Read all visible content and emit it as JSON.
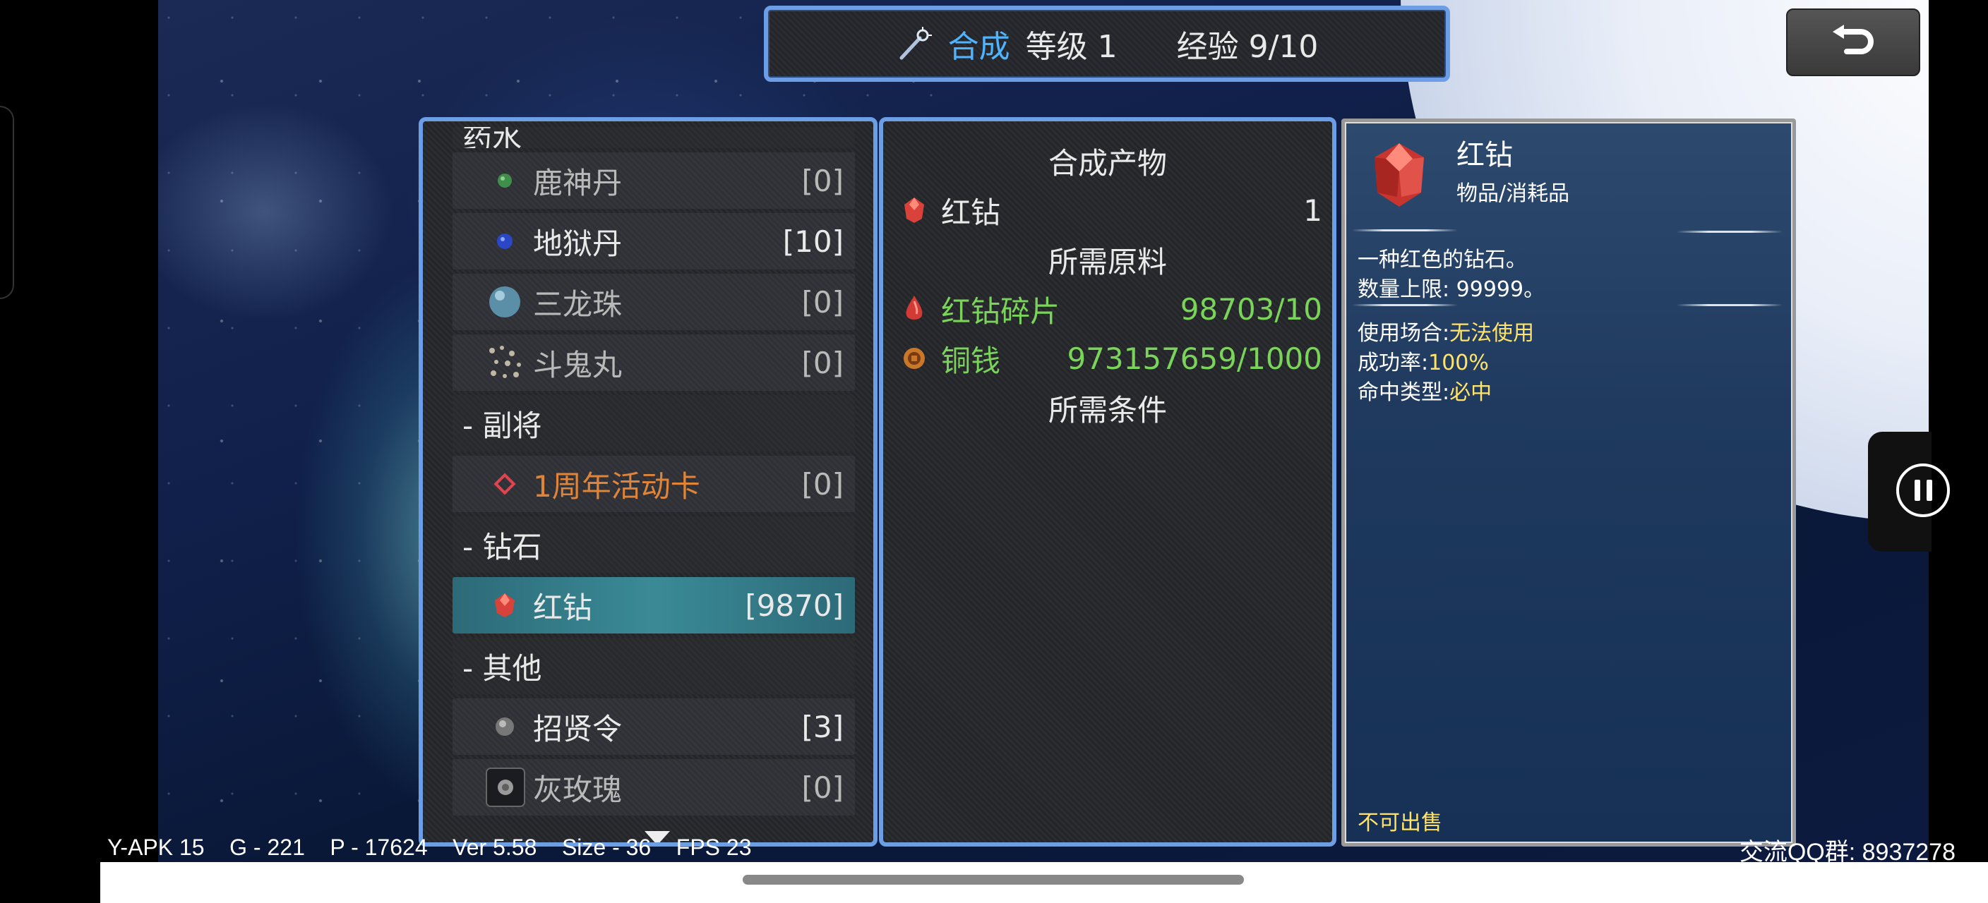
{
  "header": {
    "title": "合成",
    "level": "等级 1",
    "exp": "经验 9/10"
  },
  "list": {
    "partial_section": "药水",
    "items": [
      {
        "name": "鹿神丹",
        "count": "[0]",
        "icon": "green-pill-icon"
      },
      {
        "name": "地狱丹",
        "count": "[10]",
        "icon": "blue-pill-icon"
      },
      {
        "name": "三龙珠",
        "count": "[0]",
        "icon": "orb-icon"
      },
      {
        "name": "斗鬼丸",
        "count": "[0]",
        "icon": "scatter-pills-icon"
      }
    ],
    "section_deputy": "- 副将",
    "deputy_items": [
      {
        "name": "1周年活动卡",
        "count": "[0]",
        "icon": "diamond-card-icon"
      }
    ],
    "section_gem": "- 钻石",
    "gem_items": [
      {
        "name": "红钻",
        "count": "[9870]",
        "icon": "red-gem-icon"
      }
    ],
    "section_other": "- 其他",
    "other_items": [
      {
        "name": "招贤令",
        "count": "[3]",
        "icon": "token-icon"
      },
      {
        "name": "灰玫瑰",
        "count": "[0]",
        "icon": "gray-rose-icon"
      }
    ]
  },
  "middle": {
    "product_title": "合成产物",
    "product": {
      "name": "红钻",
      "qty": "1"
    },
    "materials_title": "所需原料",
    "materials": [
      {
        "name": "红钻碎片",
        "qty": "98703/10"
      },
      {
        "name": "铜钱",
        "qty": "973157659/1000"
      }
    ],
    "conditions_title": "所需条件"
  },
  "detail": {
    "name": "红钻",
    "category": "物品/消耗品",
    "desc1": "一种红色的钻石。",
    "desc2": "数量上限: 99999。",
    "use_label": "使用场合:",
    "use_value": "无法使用",
    "rate_label": "成功率:",
    "rate_value": "100%",
    "hit_label": "命中类型:",
    "hit_value": "必中",
    "footer": "不可出售"
  },
  "debug": {
    "text": "Y-APK 15    G - 221    P - 17624    Ver 5.58    Size - 36    FPS 23"
  },
  "qq": "交流QQ群:  8937278",
  "colors": {
    "panel_border": "#6c9ee6",
    "title_blue": "#4fb4ff",
    "green_text": "#7bd45a",
    "yellow_text": "#ffe36a",
    "selected_row": "#3a8a96"
  }
}
